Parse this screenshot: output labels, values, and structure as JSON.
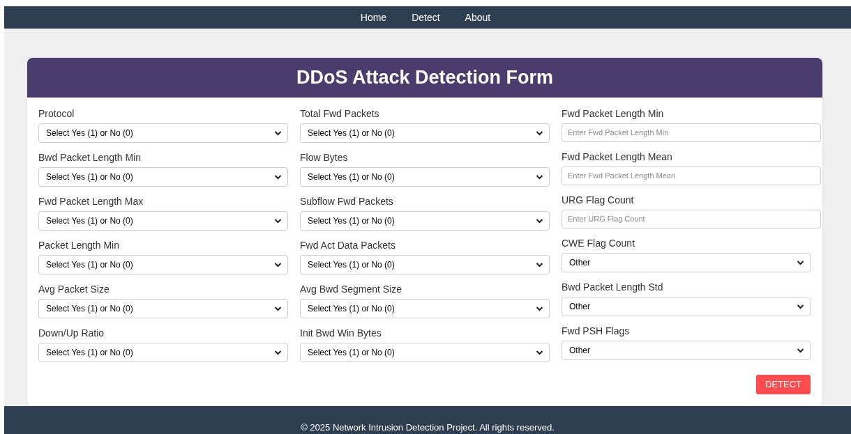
{
  "nav": {
    "links": [
      {
        "label": "Home"
      },
      {
        "label": "Detect"
      },
      {
        "label": "About"
      }
    ]
  },
  "form": {
    "title": "DDoS Attack Detection Form",
    "columns": [
      {
        "fields": [
          {
            "label": "Protocol",
            "kind": "select",
            "value": "Select Yes (1) or No (0)"
          },
          {
            "label": "Bwd Packet Length Min",
            "kind": "select",
            "value": "Select Yes (1) or No (0)"
          },
          {
            "label": "Fwd Packet Length Max",
            "kind": "select",
            "value": "Select Yes (1) or No (0)"
          },
          {
            "label": "Packet Length Min",
            "kind": "select",
            "value": "Select Yes (1) or No (0)"
          },
          {
            "label": "Avg Packet Size",
            "kind": "select",
            "value": "Select Yes (1) or No (0)"
          },
          {
            "label": "Down/Up Ratio",
            "kind": "select",
            "value": "Select Yes (1) or No (0)"
          }
        ]
      },
      {
        "fields": [
          {
            "label": "Total Fwd Packets",
            "kind": "select",
            "value": "Select Yes (1) or No (0)"
          },
          {
            "label": "Flow Bytes",
            "kind": "select",
            "value": "Select Yes (1) or No (0)"
          },
          {
            "label": "Subflow Fwd Packets",
            "kind": "select",
            "value": "Select Yes (1) or No (0)"
          },
          {
            "label": "Fwd Act Data Packets",
            "kind": "select",
            "value": "Select Yes (1) or No (0)"
          },
          {
            "label": "Avg Bwd Segment Size",
            "kind": "select",
            "value": "Select Yes (1) or No (0)"
          },
          {
            "label": "Init Bwd Win Bytes",
            "kind": "select",
            "value": "Select Yes (1) or No (0)"
          }
        ]
      },
      {
        "fields": [
          {
            "label": "Fwd Packet Length Min",
            "kind": "input",
            "placeholder": "Enter Fwd Packet Length Min"
          },
          {
            "label": "Fwd Packet Length Mean",
            "kind": "input",
            "placeholder": "Enter Fwd Packet Length Mean"
          },
          {
            "label": "URG Flag Count",
            "kind": "input",
            "placeholder": "Enter URG Flag Count"
          },
          {
            "label": "CWE Flag Count",
            "kind": "select",
            "value": "Other"
          },
          {
            "label": "Bwd Packet Length Std",
            "kind": "select",
            "value": "Other"
          },
          {
            "label": "Fwd PSH Flags",
            "kind": "select",
            "value": "Other"
          }
        ]
      }
    ],
    "submit": "DETECT"
  },
  "footer": {
    "text": "© 2025 Network Intrusion Detection Project. All rights reserved."
  }
}
